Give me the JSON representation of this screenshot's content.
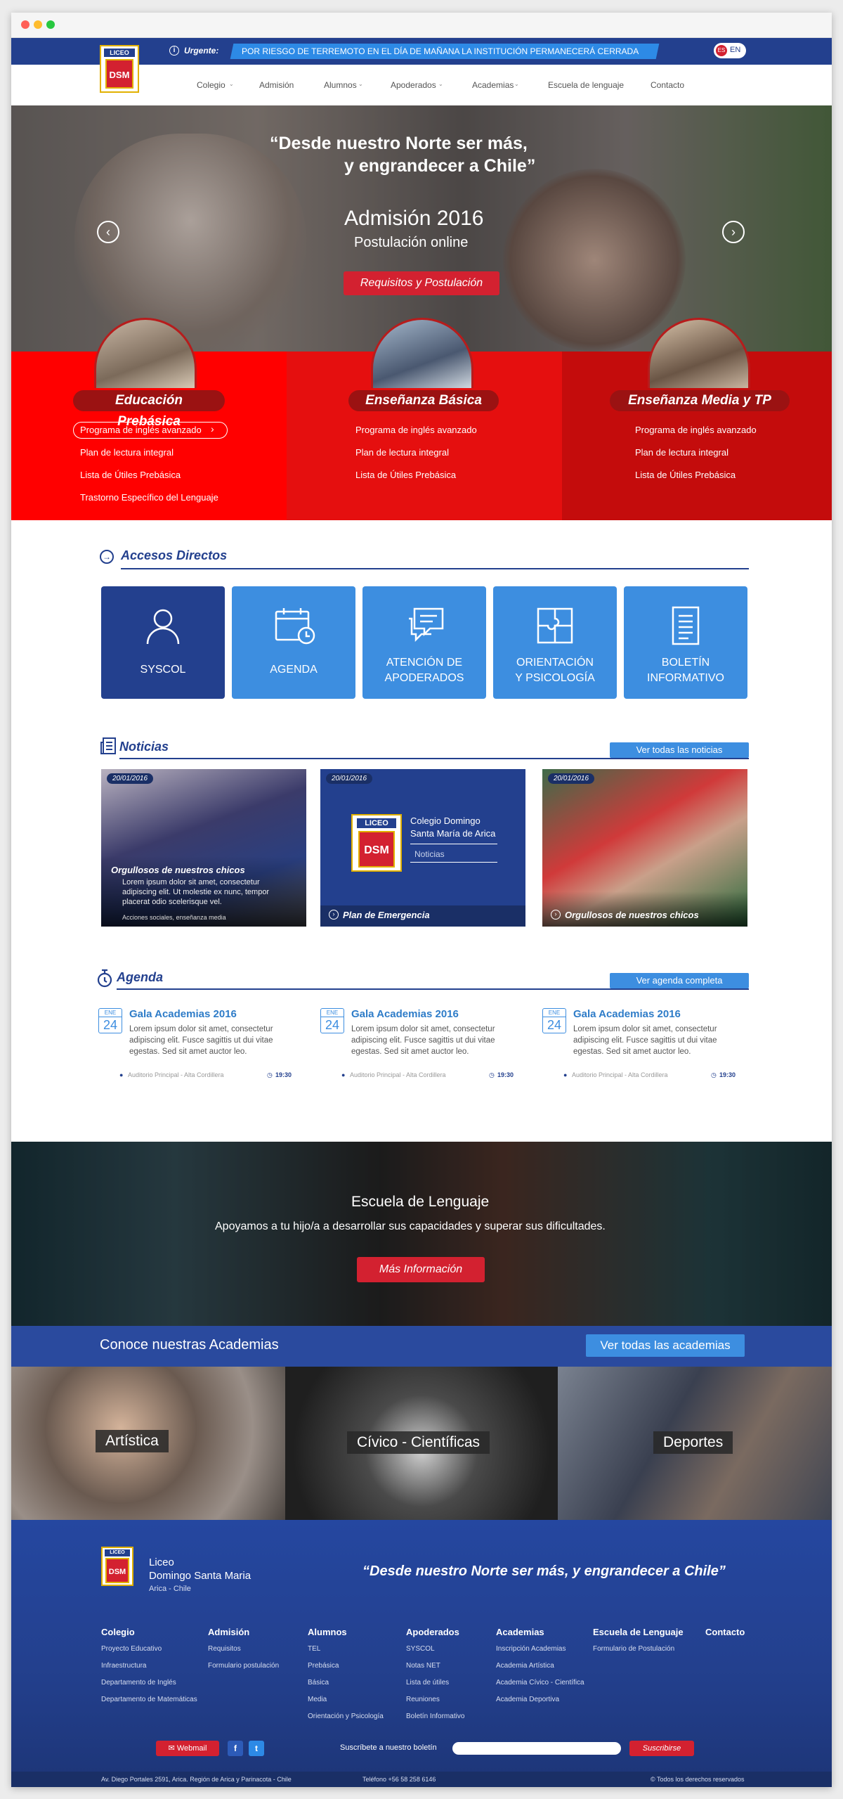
{
  "colors": {
    "brand_blue": "#23408e",
    "accent_blue": "#3d8ee0",
    "red": "#d32130",
    "level_1": "#ff0000",
    "level_2": "#e50f0f",
    "level_3": "#c40c0c"
  },
  "alert": {
    "label": "Urgente:",
    "message": "POR RIESGO DE TERREMOTO EN EL DÍA DE MAÑANA LA INSTITUCIÓN PERMANECERÁ CERRADA",
    "lang_es": "ES",
    "lang_en": "EN",
    "icon": "info-icon"
  },
  "logo": {
    "top": "LICEO",
    "letters": "DSM"
  },
  "nav": {
    "items": [
      "Colegio",
      "Admisión",
      "Alumnos",
      "Apoderados",
      "Academias",
      "Escuela de lenguaje",
      "Contacto"
    ]
  },
  "hero": {
    "quote_line1": "“Desde nuestro Norte ser más,",
    "quote_line2": "y engrandecer a Chile”",
    "title": "Admisión 2016",
    "subtitle": "Postulación online",
    "button": "Requisitos y Postulación"
  },
  "levels": [
    {
      "title": "Educación Prebásica",
      "links": [
        "Programa de inglés avanzado",
        "Plan de lectura integral",
        "Lista de Útiles Prebásica",
        "Trastorno Específico del Lenguaje"
      ]
    },
    {
      "title": "Enseñanza Básica",
      "links": [
        "Programa de inglés avanzado",
        "Plan de lectura integral",
        "Lista de Útiles Prebásica"
      ]
    },
    {
      "title": "Enseñanza Media y TP",
      "links": [
        "Programa de inglés avanzado",
        "Plan de lectura integral",
        "Lista de Útiles Prebásica"
      ]
    }
  ],
  "accesos": {
    "title": "Accesos Directos",
    "tiles": [
      {
        "label1": "SYSCOL",
        "label2": "",
        "icon": "user-icon"
      },
      {
        "label1": "AGENDA",
        "label2": "",
        "icon": "calendar-icon"
      },
      {
        "label1": "ATENCIÓN DE",
        "label2": "APODERADOS",
        "icon": "chat-icon"
      },
      {
        "label1": "ORIENTACIÓN",
        "label2": "Y PSICOLOGÍA",
        "icon": "puzzle-icon"
      },
      {
        "label1": "BOLETÍN",
        "label2": "INFORMATIVO",
        "icon": "document-icon"
      }
    ]
  },
  "noticias": {
    "title": "Noticias",
    "button": "Ver todas las noticias",
    "items": [
      {
        "date": "20/01/2016",
        "title": "Orgullosos de nuestros chicos",
        "excerpt": "Lorem ipsum dolor sit amet, consectetur adipiscing elit. Ut molestie ex nunc, tempor placerat odio scelerisque vel.",
        "tags": "Acciones sociales, enseñanza media"
      },
      {
        "date": "20/01/2016",
        "title": "Plan de Emergencia",
        "school_line1": "Colegio Domingo",
        "school_line2": "Santa María de Arica",
        "section": "Noticias"
      },
      {
        "date": "20/01/2016",
        "title": "Orgullosos de nuestros chicos"
      }
    ]
  },
  "agenda": {
    "title": "Agenda",
    "button": "Ver agenda completa",
    "items": [
      {
        "month": "ENE",
        "day": "24",
        "title": "Gala Academias 2016",
        "text": "Lorem ipsum dolor sit amet, consectetur adipiscing elit. Fusce sagittis ut dui vitae egestas. Sed sit amet auctor leo.",
        "place": "Auditorio Principal - Alta Cordillera",
        "time": "19:30"
      },
      {
        "month": "ENE",
        "day": "24",
        "title": "Gala Academias 2016",
        "text": "Lorem ipsum dolor sit amet, consectetur adipiscing elit. Fusce sagittis ut dui vitae egestas. Sed sit amet auctor leo.",
        "place": "Auditorio Principal - Alta Cordillera",
        "time": "19:30"
      },
      {
        "month": "ENE",
        "day": "24",
        "title": "Gala Academias 2016",
        "text": "Lorem ipsum dolor sit amet, consectetur adipiscing elit. Fusce sagittis ut dui vitae egestas. Sed sit amet auctor leo.",
        "place": "Auditorio Principal - Alta Cordillera",
        "time": "19:30"
      }
    ]
  },
  "escuela": {
    "title": "Escuela de Lenguaje",
    "subtitle": "Apoyamos a tu hijo/a a desarrollar sus capacidades y superar sus dificultades.",
    "button": "Más Información"
  },
  "academias": {
    "title": "Conoce nuestras Academias",
    "button": "Ver todas las academias",
    "items": [
      "Artística",
      "Cívico - Científicas",
      "Deportes"
    ]
  },
  "footer": {
    "school_line1": "Liceo",
    "school_line2": "Domingo Santa Maria",
    "school_line3": "Arica - Chile",
    "quote": "“Desde nuestro Norte ser más, y engrandecer a Chile”",
    "columns": [
      {
        "title": "Colegio",
        "links": [
          "Proyecto Educativo",
          "Infraestructura",
          "Departamento de Inglés",
          "Departamento de Matemáticas"
        ]
      },
      {
        "title": "Admisión",
        "links": [
          "Requisitos",
          "Formulario postulación"
        ]
      },
      {
        "title": "Alumnos",
        "links": [
          "TEL",
          "Prebásica",
          "Básica",
          "Media",
          "Orientación y Psicología"
        ]
      },
      {
        "title": "Apoderados",
        "links": [
          "SYSCOL",
          "Notas NET",
          "Lista de útiles",
          "Reuniones",
          "Boletín Informativo"
        ]
      },
      {
        "title": "Academias",
        "links": [
          "Inscripción Academias",
          "Academia Artística",
          "Academia Cívico - Científica",
          "Academia Deportiva"
        ]
      },
      {
        "title": "Escuela de Lenguaje",
        "links": [
          "Formulario de Postulación"
        ]
      },
      {
        "title": "Contacto",
        "links": []
      }
    ],
    "webmail": "Webmail",
    "facebook": "f",
    "twitter": "t",
    "newsletter_label": "Suscríbete a nuestro boletín",
    "newsletter_button": "Suscribirse",
    "address": "Av. Diego Portales 2591, Arica. Región de Arica y Parinacota - Chile",
    "phone": "Teléfono +56 58 258 6146",
    "rights": "© Todos los derechos reservados"
  }
}
